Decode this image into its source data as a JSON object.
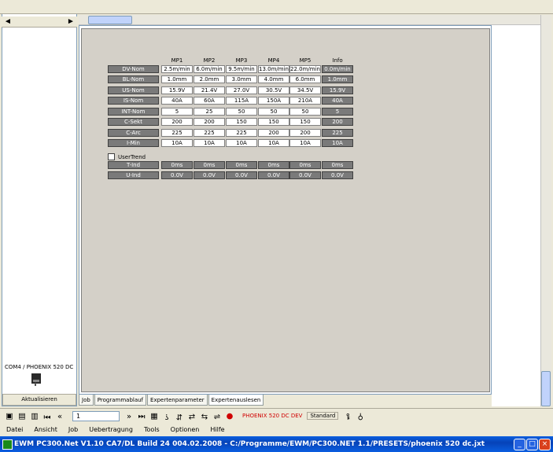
{
  "window": {
    "title": "EWM PC300.Net V1.10 CA7/DL Build 24 004.02.2008 - C:/Programme/EWM/PC300.NET 1.1/PRESETS/phoenix 520 dc.jxt"
  },
  "menu": [
    "Datei",
    "Ansicht",
    "Job",
    "Uebertragung",
    "Tools",
    "Optionen",
    "Hilfe"
  ],
  "toolbar": {
    "page": "1",
    "device": "PHOENIX 520 DC DEV",
    "standard": "Standard"
  },
  "left_panel": {
    "refresh_button": "Aktualisieren",
    "device_name": "COM4 / PHOENIX 520 DC"
  },
  "tabs": [
    "Job",
    "Programmablauf",
    "Expertenparameter",
    "Expertenauslesen"
  ],
  "active_tab": 3,
  "grid": {
    "columns": [
      "MP1",
      "MP2",
      "MP3",
      "MP4",
      "MP5",
      "Info"
    ],
    "rows": [
      {
        "label": "DV-Nom",
        "values": [
          "2.5m/min",
          "6.0m/min",
          "9.5m/min",
          "13.0m/min",
          "22.0m/min",
          "0.0m/min"
        ]
      },
      {
        "label": "BL-Nom",
        "values": [
          "1.0mm",
          "2.0mm",
          "3.0mm",
          "4.0mm",
          "6.0mm",
          "1.0mm"
        ]
      },
      {
        "label": "US-Nom",
        "values": [
          "15.9V",
          "21.4V",
          "27.0V",
          "30.5V",
          "34.5V",
          "15.9V"
        ]
      },
      {
        "label": "IS-Nom",
        "values": [
          "40A",
          "60A",
          "115A",
          "150A",
          "210A",
          "40A"
        ]
      },
      {
        "label": "INT-Nom",
        "values": [
          "5",
          "25",
          "50",
          "50",
          "50",
          "5"
        ]
      },
      {
        "label": "C-Sekt",
        "values": [
          "200",
          "200",
          "150",
          "150",
          "150",
          "200"
        ]
      },
      {
        "label": "C-Arc",
        "values": [
          "225",
          "225",
          "225",
          "200",
          "200",
          "225"
        ]
      },
      {
        "label": "I-Min",
        "values": [
          "10A",
          "10A",
          "10A",
          "10A",
          "10A",
          "10A"
        ]
      },
      {
        "label": "T-Ind",
        "values": [
          "0ms",
          "0ms",
          "0ms",
          "0ms",
          "0ms",
          "0ms"
        ]
      },
      {
        "label": "U-Ind",
        "values": [
          "0.0V",
          "0.0V",
          "0.0V",
          "0.0V",
          "0.0V",
          "0.0V"
        ]
      }
    ],
    "checkbox_label": "UserTrend",
    "row_with_checkbox_before": 8
  },
  "window_buttons": {
    "minimize": "_",
    "maximize": "□",
    "close": "×"
  }
}
